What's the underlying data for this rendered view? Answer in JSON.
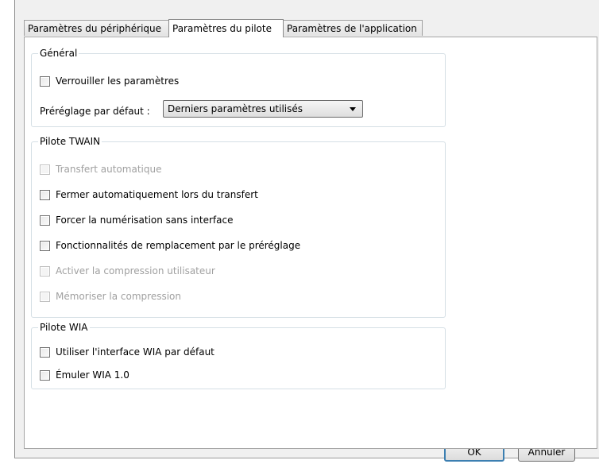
{
  "tabs": [
    {
      "label": "Paramètres du périphérique"
    },
    {
      "label": "Paramètres du pilote"
    },
    {
      "label": "Paramètres de l'application"
    }
  ],
  "active_tab": "Paramètres du pilote",
  "general": {
    "title": "Général",
    "lock_label": "Verrouiller les paramètres",
    "preset_label": "Préréglage par défaut :",
    "preset_value": "Derniers paramètres utilisés"
  },
  "twain": {
    "title": "Pilote TWAIN",
    "options": [
      {
        "label": "Transfert automatique",
        "enabled": false,
        "checked": false
      },
      {
        "label": "Fermer automatiquement lors du transfert",
        "enabled": true,
        "checked": false
      },
      {
        "label": "Forcer la numérisation sans interface",
        "enabled": true,
        "checked": false
      },
      {
        "label": "Fonctionnalités de remplacement par le préréglage",
        "enabled": true,
        "checked": false
      },
      {
        "label": "Activer la compression utilisateur",
        "enabled": false,
        "checked": false
      },
      {
        "label": "Mémoriser la compression",
        "enabled": false,
        "checked": false
      }
    ]
  },
  "wia": {
    "title": "Pilote WIA",
    "options": [
      {
        "label": "Utiliser l'interface WIA par défaut",
        "enabled": true,
        "checked": false
      },
      {
        "label": "Émuler WIA 1.0",
        "enabled": true,
        "checked": false
      }
    ]
  },
  "buttons": {
    "ok": "OK",
    "cancel": "Annuler"
  },
  "colors": {
    "window_bg": "#f0f0f0",
    "panel_bg": "#ffffff",
    "default_button_border": "#3c7fb1",
    "disabled_text": "#a0a0a0"
  }
}
